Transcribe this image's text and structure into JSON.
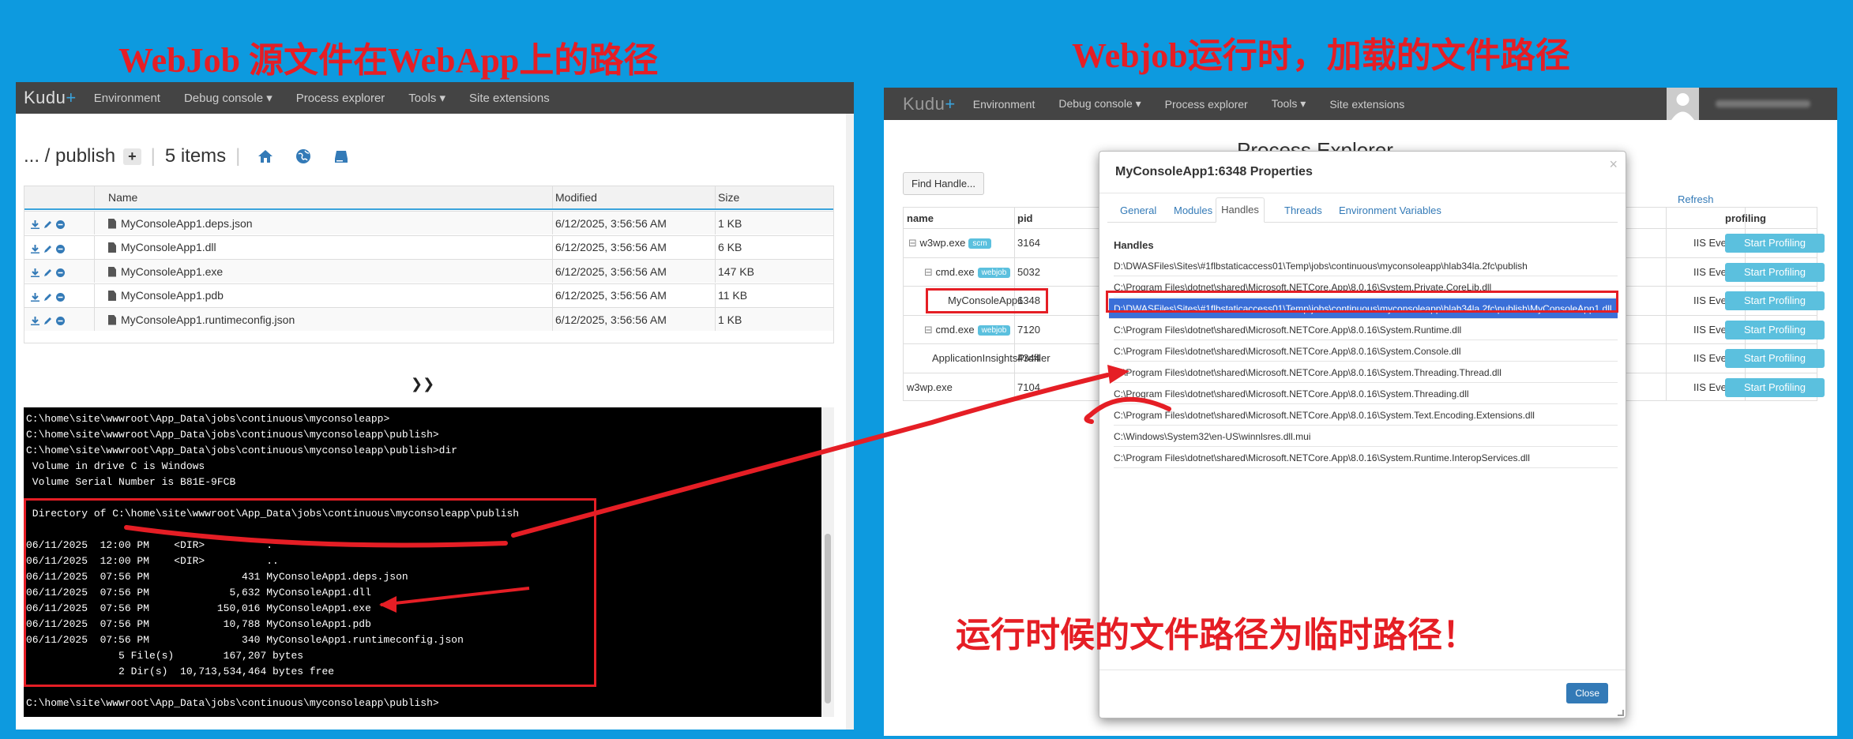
{
  "titles": {
    "left": "WebJob 源文件在WebApp上的路径",
    "right": "Webjob运行时，加载的文件路径",
    "note": "运行时候的文件路径为临时路径！"
  },
  "colors": {
    "annotation": "#e51e25",
    "background": "#0d9adf",
    "navbar": "#444444",
    "accent": "#3aa3dc"
  },
  "left_panel": {
    "nav": {
      "brand": "Kudu",
      "brand_plus": "+",
      "items": [
        "Environment",
        "Debug console ▾",
        "Process explorer",
        "Tools ▾",
        "Site extensions"
      ]
    },
    "breadcrumb": {
      "path": "... / publish",
      "add": "+",
      "count": "5 items"
    },
    "icons": [
      "home-icon",
      "globe-icon",
      "drive-icon"
    ],
    "table": {
      "headers": [
        "Name",
        "Modified",
        "Size"
      ],
      "rows": [
        {
          "name": "MyConsoleApp1.deps.json",
          "modified": "6/12/2025, 3:56:56 AM",
          "size": "1 KB"
        },
        {
          "name": "MyConsoleApp1.dll",
          "modified": "6/12/2025, 3:56:56 AM",
          "size": "6 KB"
        },
        {
          "name": "MyConsoleApp1.exe",
          "modified": "6/12/2025, 3:56:56 AM",
          "size": "147 KB"
        },
        {
          "name": "MyConsoleApp1.pdb",
          "modified": "6/12/2025, 3:56:56 AM",
          "size": "11 KB"
        },
        {
          "name": "MyConsoleApp1.runtimeconfig.json",
          "modified": "6/12/2025, 3:56:56 AM",
          "size": "1 KB"
        }
      ]
    },
    "console": {
      "toggle": "⌄⌃",
      "lines": [
        "C:\\home\\site\\wwwroot\\App_Data\\jobs\\continuous\\myconsoleapp>",
        "C:\\home\\site\\wwwroot\\App_Data\\jobs\\continuous\\myconsoleapp\\publish>",
        "C:\\home\\site\\wwwroot\\App_Data\\jobs\\continuous\\myconsoleapp\\publish>dir",
        " Volume in drive C is Windows",
        " Volume Serial Number is B81E-9FCB",
        "",
        " Directory of C:\\home\\site\\wwwroot\\App_Data\\jobs\\continuous\\myconsoleapp\\publish",
        "",
        "06/11/2025  12:00 PM    <DIR>          .",
        "06/11/2025  12:00 PM    <DIR>          ..",
        "06/11/2025  07:56 PM               431 MyConsoleApp1.deps.json",
        "06/11/2025  07:56 PM             5,632 MyConsoleApp1.dll",
        "06/11/2025  07:56 PM           150,016 MyConsoleApp1.exe",
        "06/11/2025  07:56 PM            10,788 MyConsoleApp1.pdb",
        "06/11/2025  07:56 PM               340 MyConsoleApp1.runtimeconfig.json",
        "               5 File(s)        167,207 bytes",
        "               2 Dir(s)  10,713,534,464 bytes free",
        "",
        "C:\\home\\site\\wwwroot\\App_Data\\jobs\\continuous\\myconsoleapp\\publish>"
      ]
    }
  },
  "right_panel": {
    "nav": {
      "brand": "Kudu",
      "brand_plus": "+",
      "items": [
        "Environment",
        "Debug console ▾",
        "Process explorer",
        "Tools ▾",
        "Site extensions"
      ]
    },
    "page_title": "Process Explorer",
    "find_handle": "Find Handle...",
    "refresh": "Refresh",
    "headers": {
      "name": "name",
      "pid": "pid",
      "profiling": "profiling"
    },
    "processes": [
      {
        "name": "w3wp.exe",
        "prefix": "⊟",
        "badge": "scm",
        "pid": "3164",
        "events": "IIS Events"
      },
      {
        "name": "cmd.exe",
        "prefix": "⊟",
        "badge": "webjob",
        "pid": "5032",
        "events": "IIS Events"
      },
      {
        "name": "MyConsoleApp1",
        "prefix": "",
        "badge": "",
        "pid": "6348",
        "events": "IIS Events"
      },
      {
        "name": "cmd.exe",
        "prefix": "⊟",
        "badge": "webjob",
        "pid": "7120",
        "events": "IIS Events"
      },
      {
        "name": "ApplicationInsightsProfiler",
        "prefix": "",
        "badge": "",
        "pid": "4344",
        "events": "IIS Events"
      },
      {
        "name": "w3wp.exe",
        "prefix": "",
        "badge": "",
        "pid": "7104",
        "events": "IIS Events"
      }
    ],
    "start_profiling": "Start Profiling",
    "modal": {
      "title": "MyConsoleApp1:6348 Properties",
      "close_x": "×",
      "tabs": [
        "General",
        "Modules",
        "Handles",
        "Threads",
        "Environment Variables"
      ],
      "active_tab": "Handles",
      "section": "Handles",
      "handles": [
        "D:\\DWASFiles\\Sites\\#1flbstaticaccess01\\Temp\\jobs\\continuous\\myconsoleapp\\hlab34la.2fc\\publish",
        "C:\\Program Files\\dotnet\\shared\\Microsoft.NETCore.App\\8.0.16\\System.Private.CoreLib.dll",
        "D:\\DWASFiles\\Sites\\#1flbstaticaccess01\\Temp\\jobs\\continuous\\myconsoleapp\\hlab34la.2fc\\publish\\MyConsoleApp1.dll",
        "C:\\Program Files\\dotnet\\shared\\Microsoft.NETCore.App\\8.0.16\\System.Runtime.dll",
        "C:\\Program Files\\dotnet\\shared\\Microsoft.NETCore.App\\8.0.16\\System.Console.dll",
        "C:\\Program Files\\dotnet\\shared\\Microsoft.NETCore.App\\8.0.16\\System.Threading.Thread.dll",
        "C:\\Program Files\\dotnet\\shared\\Microsoft.NETCore.App\\8.0.16\\System.Threading.dll",
        "C:\\Program Files\\dotnet\\shared\\Microsoft.NETCore.App\\8.0.16\\System.Text.Encoding.Extensions.dll",
        "C:\\Windows\\System32\\en-US\\winnlsres.dll.mui",
        "C:\\Program Files\\dotnet\\shared\\Microsoft.NETCore.App\\8.0.16\\System.Runtime.InteropServices.dll"
      ],
      "close_button": "Close"
    }
  }
}
